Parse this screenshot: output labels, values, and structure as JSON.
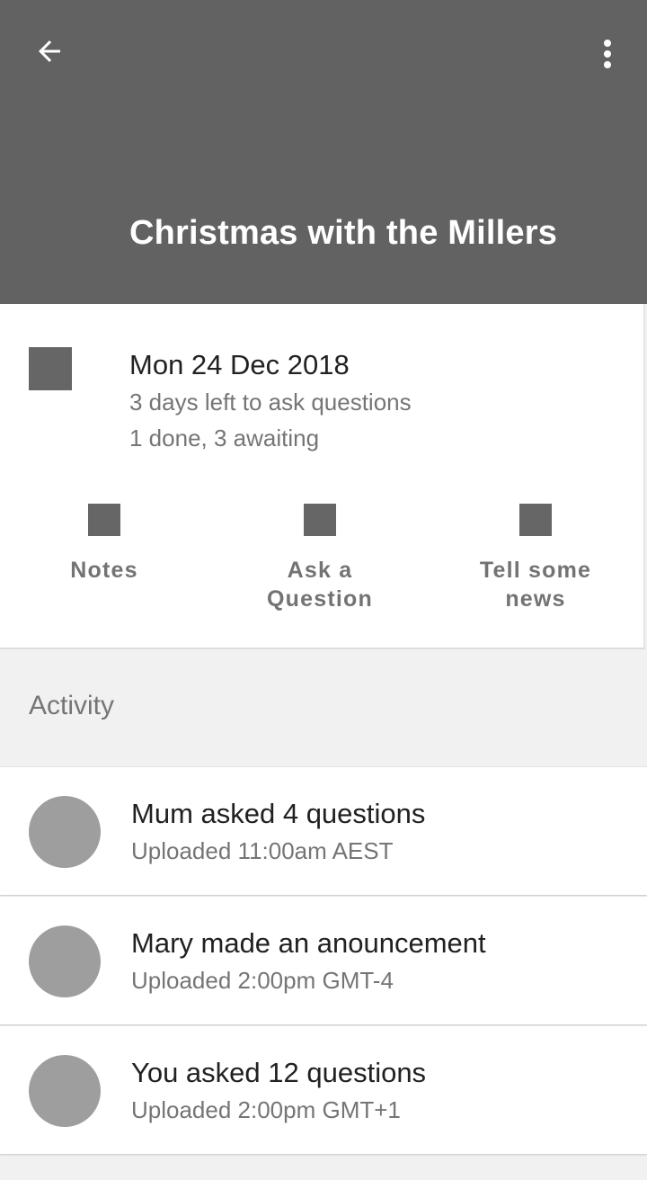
{
  "appbar": {
    "back_icon": "arrow-back-icon",
    "menu_icon": "more-vert-icon",
    "title": "Christmas with the Millers",
    "color": "#626262"
  },
  "event": {
    "icon": "calendar-icon",
    "date": "Mon 24 Dec 2018",
    "days_left": "3 days left to ask questions",
    "status": "1 done, 3 awaiting"
  },
  "actions": [
    {
      "icon": "notes-icon",
      "label_lines": [
        "Notes"
      ]
    },
    {
      "icon": "question-icon",
      "label_lines": [
        "Ask a",
        "Question"
      ]
    },
    {
      "icon": "news-icon",
      "label_lines": [
        "Tell some",
        "news"
      ]
    }
  ],
  "activity": {
    "header": "Activity",
    "items": [
      {
        "title": "Mum asked 4 questions",
        "subtitle": "Uploaded 11:00am AEST"
      },
      {
        "title": "Mary made an anouncement",
        "subtitle": "Uploaded 2:00pm GMT-4"
      },
      {
        "title": "You asked 12 questions",
        "subtitle": "Uploaded 2:00pm GMT+1"
      }
    ]
  }
}
